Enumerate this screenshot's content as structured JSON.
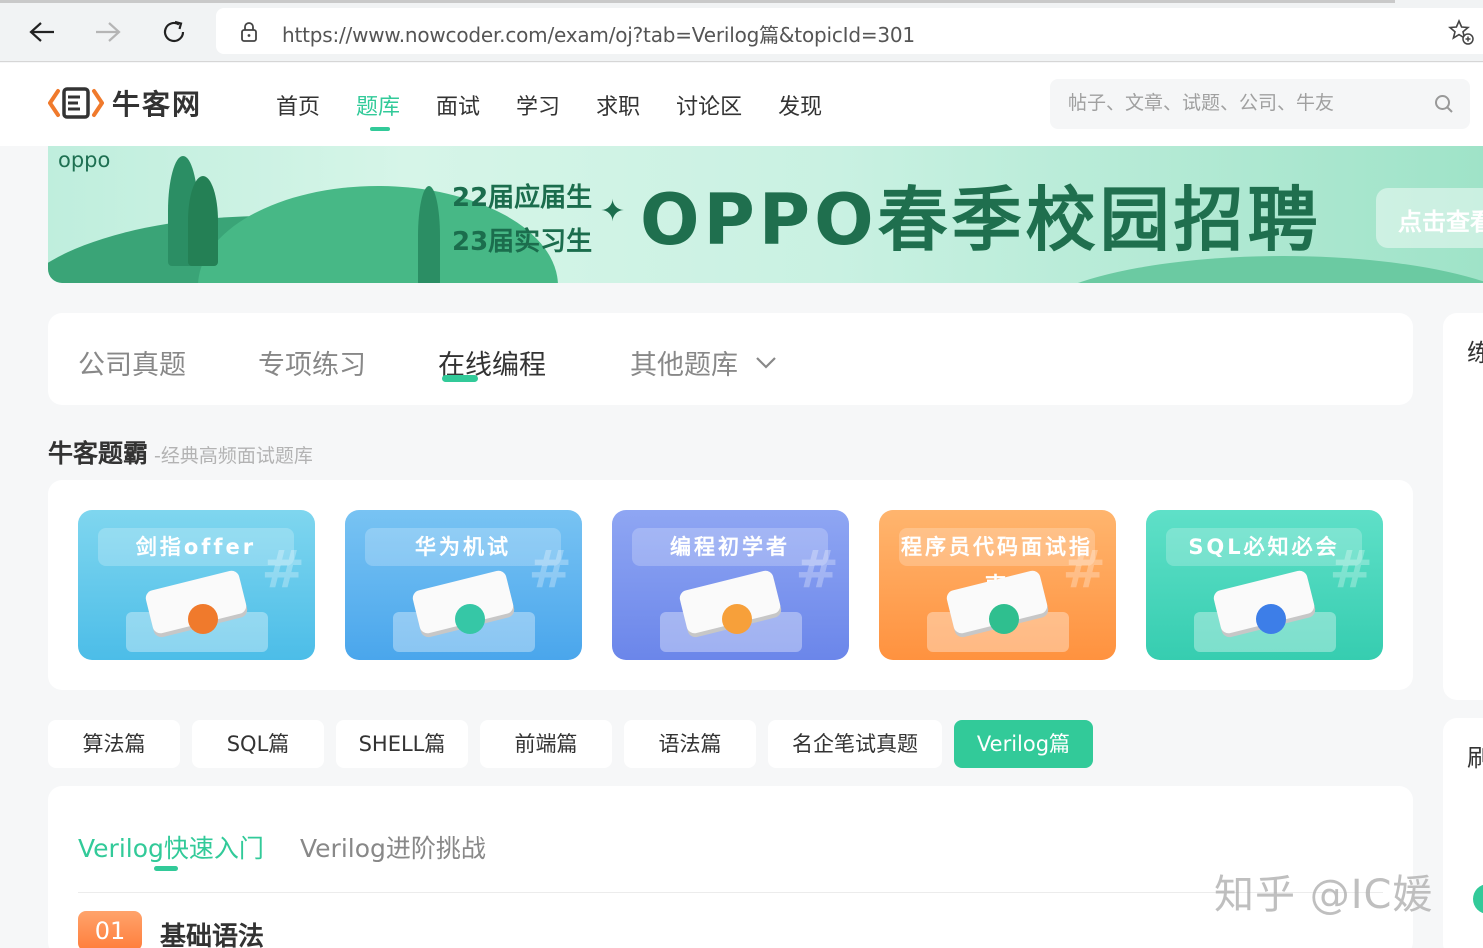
{
  "browser": {
    "url": "https://www.nowcoder.com/exam/oj?tab=Verilog篇&topicId=301"
  },
  "site": {
    "logo_text": "牛客网",
    "nav": [
      {
        "label": "首页",
        "active": false
      },
      {
        "label": "题库",
        "active": true
      },
      {
        "label": "面试",
        "active": false
      },
      {
        "label": "学习",
        "active": false
      },
      {
        "label": "求职",
        "active": false
      },
      {
        "label": "讨论区",
        "active": false
      },
      {
        "label": "发现",
        "active": false
      }
    ],
    "search_placeholder": "帖子、文章、试题、公司、牛友"
  },
  "banner": {
    "brand": "oppo",
    "line1": "22届应届生",
    "line2": "23届实习生",
    "sparkle": "✦",
    "headline": "OPPO春季校园招聘",
    "cta": "点击查看"
  },
  "category_tabs": [
    {
      "label": "公司真题",
      "active": false
    },
    {
      "label": "专项练习",
      "active": false
    },
    {
      "label": "在线编程",
      "active": true
    },
    {
      "label": "其他题库",
      "active": false,
      "has_dropdown": true
    }
  ],
  "right_cards": [
    {
      "title": "练"
    },
    {
      "title": "刷"
    }
  ],
  "section": {
    "title": "牛客题霸",
    "subtitle": "-经典高频面试题库"
  },
  "courses": [
    {
      "label": "剑指offer",
      "color_top": "#7fd6ef",
      "color_bottom": "#4cbde8",
      "badge_color": "#f07a2c"
    },
    {
      "label": "华为机试",
      "color_top": "#78c3f3",
      "color_bottom": "#4aa6ec",
      "badge_color": "#36c7a6"
    },
    {
      "label": "编程初学者",
      "color_top": "#8fa6f3",
      "color_bottom": "#6b86ea",
      "badge_color": "#f7a03a"
    },
    {
      "label": "程序员代码面试指南",
      "color_top": "#ffb56e",
      "color_bottom": "#ff923f",
      "badge_color": "#2fbf8f"
    },
    {
      "label": "SQL必知必会",
      "color_top": "#5fe0c8",
      "color_bottom": "#36cdb0",
      "badge_color": "#3d7ee8"
    }
  ],
  "language_pills": [
    {
      "label": "算法篇",
      "active": false
    },
    {
      "label": "SQL篇",
      "active": false
    },
    {
      "label": "SHELL篇",
      "active": false
    },
    {
      "label": "前端篇",
      "active": false
    },
    {
      "label": "语法篇",
      "active": false
    },
    {
      "label": "名企笔试真题",
      "active": false
    },
    {
      "label": "Verilog篇",
      "active": true
    }
  ],
  "sub_tabs": [
    {
      "label": "Verilog快速入门",
      "active": true
    },
    {
      "label": "Verilog进阶挑战",
      "active": false
    }
  ],
  "chapter": {
    "number": "01",
    "title": "基础语法"
  },
  "watermark": "知乎 @IC媛",
  "colors": {
    "accent": "#32ca99",
    "banner_text": "#1f6f4e"
  }
}
